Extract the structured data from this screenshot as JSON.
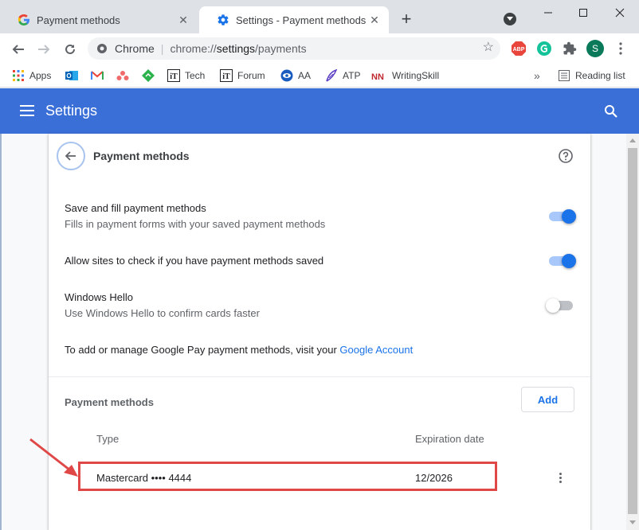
{
  "tabs": [
    {
      "title": "Payment methods",
      "active": false
    },
    {
      "title": "Settings - Payment methods",
      "active": true
    }
  ],
  "toolbar": {
    "scheme": "Chrome",
    "url_prefix": "chrome://",
    "url_host": "settings",
    "url_path": "/payments"
  },
  "bookmarks": [
    {
      "label": "Apps",
      "icon": "apps-grid-icon"
    },
    {
      "label": "",
      "icon": "outlook-icon"
    },
    {
      "label": "",
      "icon": "gmail-icon"
    },
    {
      "label": "",
      "icon": "asana-icon"
    },
    {
      "label": "",
      "icon": "feedly-icon"
    },
    {
      "label": "Tech",
      "icon": "it-icon"
    },
    {
      "label": "Forum",
      "icon": "it-icon"
    },
    {
      "label": "AA",
      "icon": "eye-icon"
    },
    {
      "label": "ATP",
      "icon": "feather-icon"
    },
    {
      "label": "WritingSkill",
      "icon": "nn-icon"
    }
  ],
  "reading_list": "Reading list",
  "avatar_letter": "S",
  "abp_label": "ABP",
  "header": {
    "title": "Settings"
  },
  "card": {
    "title": "Payment methods",
    "save_fill_label": "Save and fill payment methods",
    "save_fill_sub": "Fills in payment forms with your saved payment methods",
    "save_fill_on": true,
    "allow_check_label": "Allow sites to check if you have payment methods saved",
    "allow_check_on": true,
    "hello_label": "Windows Hello",
    "hello_sub": "Use Windows Hello to confirm cards faster",
    "hello_on": false,
    "gpay_text": "To add or manage Google Pay payment methods, visit your",
    "gpay_link": "Google Account",
    "section_title": "Payment methods",
    "add_label": "Add",
    "col_type": "Type",
    "col_expiration": "Expiration date",
    "cards": [
      {
        "type": "Mastercard •••• 4444",
        "expiration": "12/2026"
      }
    ]
  },
  "colors": {
    "header_blue": "#3b6fd8",
    "toggle_on": "#1a73e8",
    "highlight_red": "#e04848"
  }
}
